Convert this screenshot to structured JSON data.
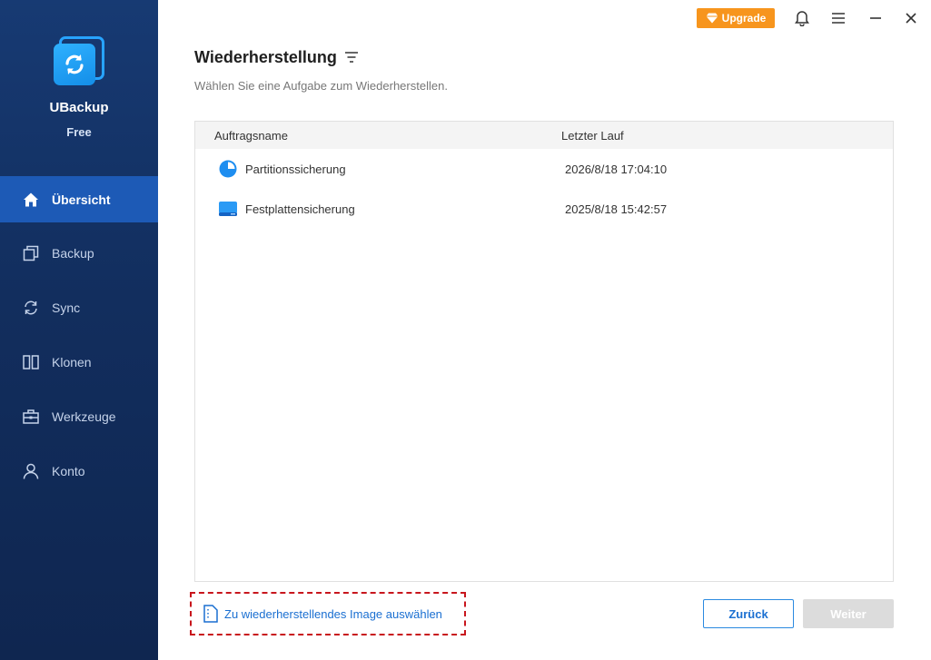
{
  "app": {
    "name": "UBackup",
    "edition": "Free"
  },
  "sidebar": {
    "items": [
      {
        "label": "Übersicht",
        "icon": "home-icon",
        "active": true
      },
      {
        "label": "Backup",
        "icon": "backup-icon",
        "active": false
      },
      {
        "label": "Sync",
        "icon": "sync-icon",
        "active": false
      },
      {
        "label": "Klonen",
        "icon": "clone-icon",
        "active": false
      },
      {
        "label": "Werkzeuge",
        "icon": "toolbox-icon",
        "active": false
      },
      {
        "label": "Konto",
        "icon": "user-icon",
        "active": false
      }
    ]
  },
  "topbar": {
    "upgrade_label": "Upgrade"
  },
  "main": {
    "title": "Wiederherstellung",
    "subtitle": "Wählen Sie eine Aufgabe zum Wiederherstellen.",
    "table": {
      "columns": [
        "Auftragsname",
        "Letzter Lauf"
      ],
      "rows": [
        {
          "name": "Partitionssicherung",
          "last_run": "2026/8/18 17:04:10",
          "icon": "partition-icon"
        },
        {
          "name": "Festplattensicherung",
          "last_run": "2025/8/18 15:42:57",
          "icon": "disk-icon"
        }
      ]
    },
    "select_image_label": "Zu wiederherstellendes Image auswählen",
    "back_label": "Zurück",
    "next_label": "Weiter"
  },
  "colors": {
    "accent": "#1d5ab6",
    "upgrade": "#f7951d",
    "link": "#1a6fd1",
    "highlight": "#c8161d"
  }
}
